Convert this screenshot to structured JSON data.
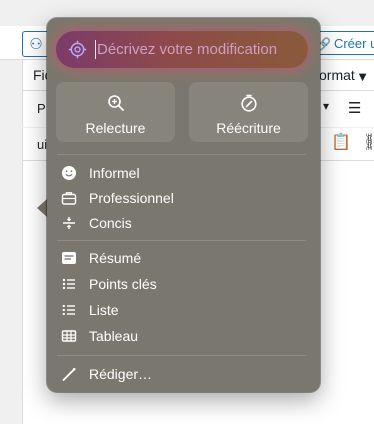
{
  "background": {
    "create_button": "Créer u",
    "menu_left": "Fic",
    "menu_right": "ormat",
    "paragraph_label": "P",
    "row3_label": "ui"
  },
  "popover": {
    "prompt_placeholder": "Décrivez votre modification",
    "actions": [
      {
        "label": "Relecture",
        "icon": "zoom-icon"
      },
      {
        "label": "Réécriture",
        "icon": "compass-icon"
      }
    ],
    "tone_items": [
      {
        "label": "Informel",
        "icon": "smiley-icon"
      },
      {
        "label": "Professionnel",
        "icon": "briefcase-icon"
      },
      {
        "label": "Concis",
        "icon": "divide-icon"
      }
    ],
    "format_items": [
      {
        "label": "Résumé",
        "icon": "summary-lines-icon"
      },
      {
        "label": "Points clés",
        "icon": "bullet-list-icon"
      },
      {
        "label": "Liste",
        "icon": "list-icon"
      },
      {
        "label": "Tableau",
        "icon": "table-icon"
      }
    ],
    "compose_item": {
      "label": "Rédiger…",
      "icon": "pencil-icon"
    }
  },
  "colors": {
    "popover_bg": "#7a776e",
    "prompt_glow_start": "#b43c96",
    "prompt_glow_end": "#c88c3c",
    "wp_blue": "#2271b1"
  }
}
